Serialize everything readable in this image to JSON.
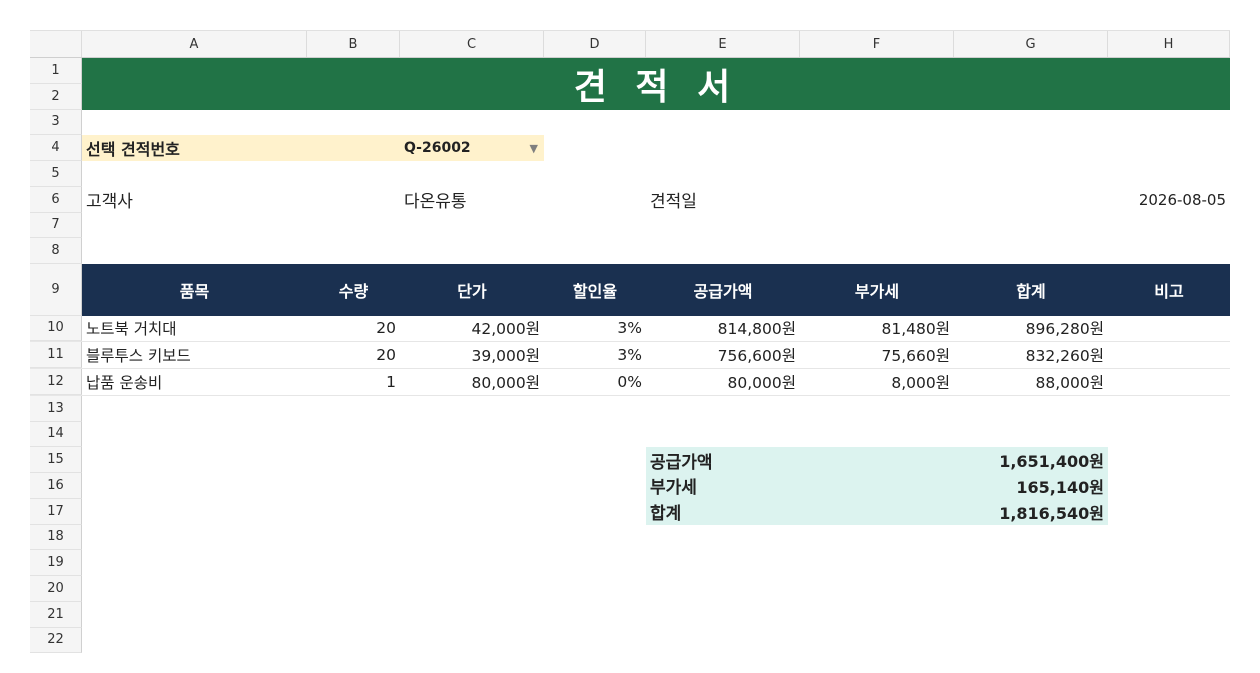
{
  "columns": [
    "A",
    "B",
    "C",
    "D",
    "E",
    "F",
    "G",
    "H"
  ],
  "rows": [
    "1",
    "2",
    "3",
    "4",
    "5",
    "6",
    "7",
    "8",
    "9",
    "10",
    "11",
    "12",
    "13",
    "14",
    "15",
    "16",
    "17",
    "18",
    "19",
    "20",
    "21",
    "22"
  ],
  "title": "견 적 서",
  "selector": {
    "label": "선택 견적번호",
    "value": "Q-26002"
  },
  "customer": {
    "label": "고객사",
    "value": "다온유통"
  },
  "date": {
    "label": "견적일",
    "value": "2026-08-05"
  },
  "table": {
    "headers": [
      "품목",
      "수량",
      "단가",
      "할인율",
      "공급가액",
      "부가세",
      "합계",
      "비고"
    ],
    "items": [
      [
        "노트북 거치대",
        "20",
        "42,000원",
        "3%",
        "814,800원",
        "81,480원",
        "896,280원",
        ""
      ],
      [
        "블루투스 키보드",
        "20",
        "39,000원",
        "3%",
        "756,600원",
        "75,660원",
        "832,260원",
        ""
      ],
      [
        "납품 운송비",
        "1",
        "80,000원",
        "0%",
        "80,000원",
        "8,000원",
        "88,000원",
        ""
      ]
    ]
  },
  "summary": [
    {
      "label": "공급가액",
      "value": "1,651,400원"
    },
    {
      "label": "부가세",
      "value": "165,140원"
    },
    {
      "label": "합계",
      "value": "1,816,540원"
    }
  ],
  "colors": {
    "title_bg": "#217346",
    "header_bg": "#1a3050",
    "selector_bg": "#fff2cc",
    "summary_bg": "#dcf3ef"
  }
}
